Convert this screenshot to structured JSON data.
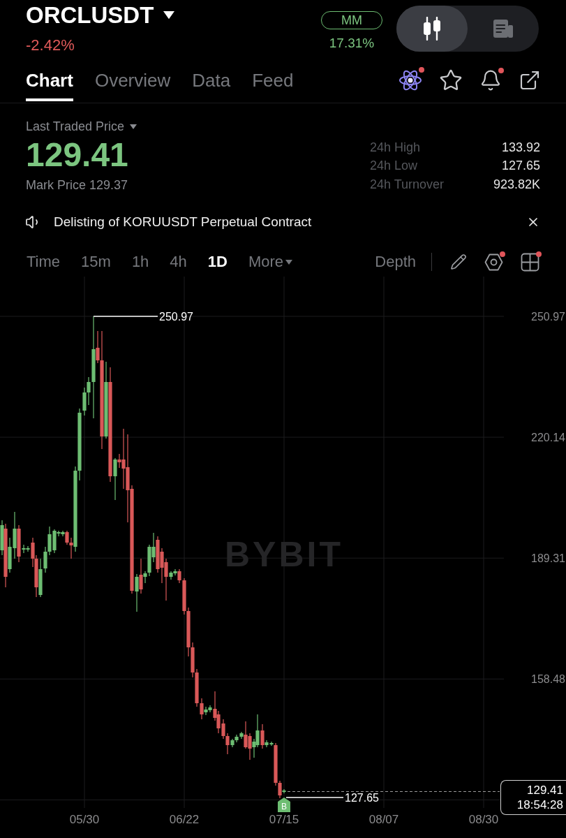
{
  "header": {
    "symbol": "ORCLUSDT",
    "change": "-2.42%",
    "mm": {
      "label": "MM",
      "value": "17.31%"
    },
    "view_toggle": [
      {
        "kind": "candles",
        "selected": true
      },
      {
        "kind": "news",
        "selected": false
      }
    ]
  },
  "tabs": [
    {
      "label": "Chart",
      "selected": true
    },
    {
      "label": "Overview",
      "selected": false
    },
    {
      "label": "Data",
      "selected": false
    },
    {
      "label": "Feed",
      "selected": false
    }
  ],
  "tab_actions": [
    {
      "kind": "atom",
      "dot": true
    },
    {
      "kind": "star",
      "dot": false
    },
    {
      "kind": "bell",
      "dot": true
    },
    {
      "kind": "share",
      "dot": false
    }
  ],
  "price": {
    "label": "Last Traded Price",
    "last": "129.41",
    "mark": "Mark Price 129.37"
  },
  "stats": [
    {
      "label": "24h High",
      "value": "133.92"
    },
    {
      "label": "24h Low",
      "value": "127.65"
    },
    {
      "label": "24h Turnover",
      "value": "923.82K"
    }
  ],
  "announcement": {
    "text": "Delisting of KORUUSDT Perpetual Contract"
  },
  "intervals": [
    {
      "label": "Time",
      "kind": "interval",
      "selected": false
    },
    {
      "label": "15m",
      "kind": "interval",
      "selected": false
    },
    {
      "label": "1h",
      "kind": "interval",
      "selected": false
    },
    {
      "label": "4h",
      "kind": "interval",
      "selected": false
    },
    {
      "label": "1D",
      "kind": "interval",
      "selected": true
    },
    {
      "label": "More",
      "kind": "menu",
      "selected": false
    }
  ],
  "chart_tools": {
    "depth": "Depth",
    "icons": [
      {
        "kind": "pencil",
        "dot": false
      },
      {
        "kind": "hexagon",
        "dot": true
      },
      {
        "kind": "grid",
        "dot": true
      }
    ]
  },
  "chart": {
    "watermark": "BYBIT",
    "y_labels": [
      "250.97",
      "220.14",
      "189.31",
      "158.48"
    ],
    "x_labels": [
      "05/30",
      "06/22",
      "07/15",
      "08/07",
      "08/30"
    ],
    "high": "250.97",
    "low": "127.65",
    "trade_marker": "B",
    "last_price": "129.41",
    "countdown": "18:54:28"
  }
}
